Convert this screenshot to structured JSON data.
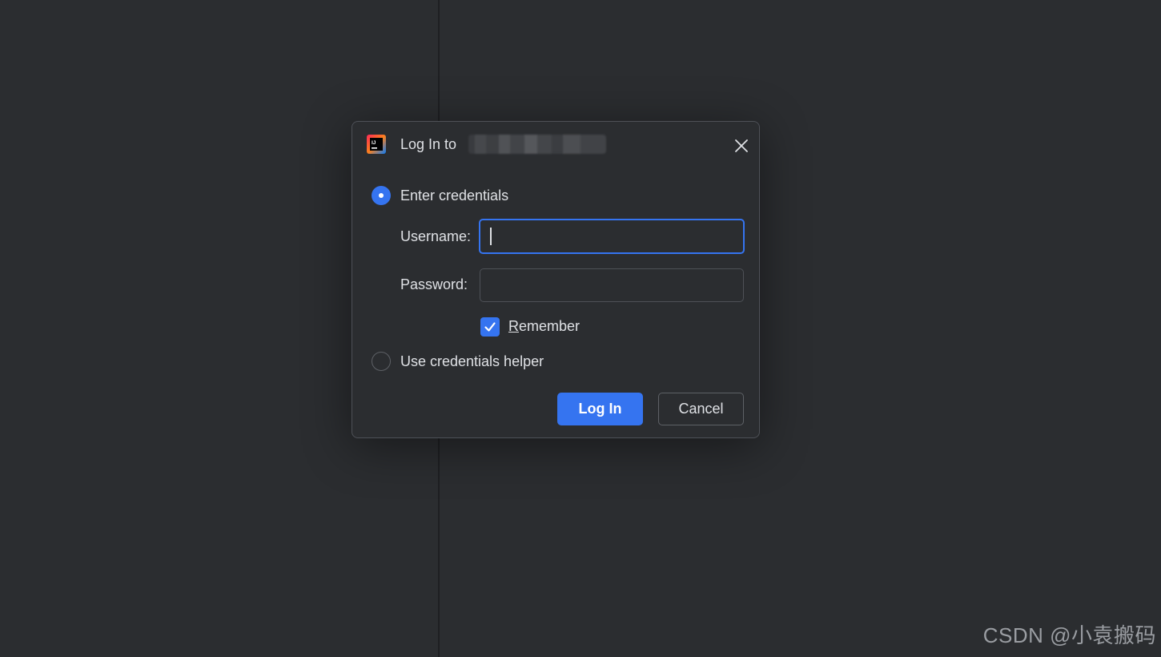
{
  "dialog": {
    "title": "Log In to ",
    "close_icon": "close-icon",
    "app_icon": "intellij-idea-icon",
    "options": {
      "enter_credentials": {
        "label": "Enter credentials",
        "selected": true
      },
      "credentials_helper": {
        "label": "Use credentials helper",
        "selected": false
      }
    },
    "username": {
      "label": "Username:",
      "value": "",
      "placeholder": ""
    },
    "password": {
      "label": "Password:",
      "value": "",
      "placeholder": ""
    },
    "remember": {
      "label_first": "R",
      "label_rest": "emember",
      "checked": true
    },
    "buttons": {
      "login": "Log In",
      "cancel": "Cancel"
    }
  },
  "watermark": "CSDN @小袁搬码",
  "colors": {
    "background": "#2b2d30",
    "accent": "#3574f0",
    "text": "#dfe1e5",
    "border": "#4e5157"
  }
}
